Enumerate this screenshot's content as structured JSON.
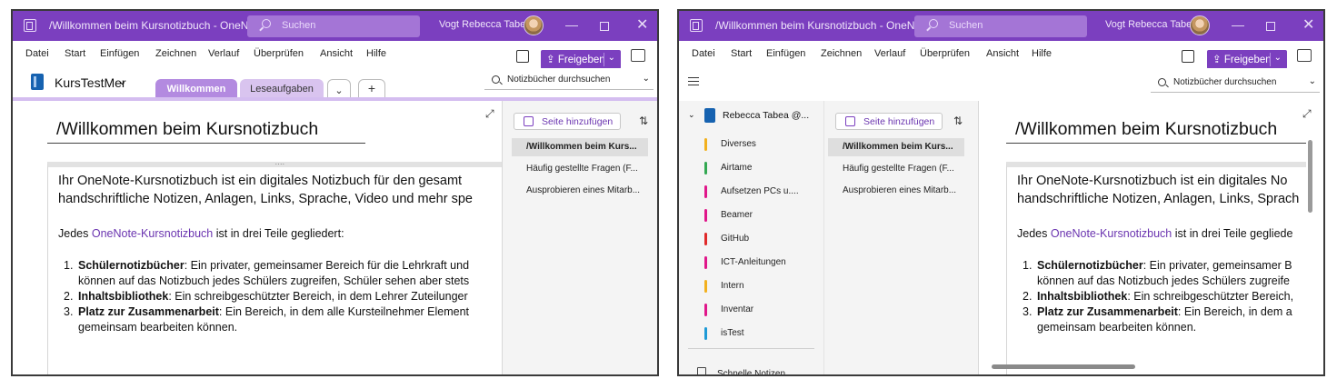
{
  "window": {
    "title": "/Willkommen beim Kursnotizbuch  -  OneN...",
    "search_placeholder": "Suchen",
    "user_name": "Vogt Rebecca Tabea",
    "accent_color": "#7b3fbf"
  },
  "menu": {
    "items": [
      "Datei",
      "Start",
      "Einfügen",
      "Zeichnen",
      "Verlauf",
      "Überprüfen",
      "Ansicht",
      "Hilfe"
    ],
    "share_label": "Freigeben"
  },
  "left": {
    "notebook_name": "KursTestMer",
    "tabs": [
      "Willkommen",
      "Leseaufgaben"
    ],
    "notebook_search": "Notizbücher durchsuchen"
  },
  "page": {
    "title": "/Willkommen beim Kursnotizbuch",
    "para1_line1_full": "Ihr OneNote-Kursnotizbuch ist ein digitales Notizbuch für den gesamt",
    "para1_line2_full": "handschriftliche Notizen, Anlagen, Links, Sprache, Video und mehr spe",
    "para1_line1_cut": "Ihr OneNote-Kursnotizbuch ist ein digitales No",
    "para1_line2_cut": "handschriftliche Notizen, Anlagen, Links, Sprach",
    "para2_prefix": "Jedes ",
    "para2_link": "OneNote-Kursnotizbuch",
    "para2_suffix_full": " ist in drei Teile gegliedert:",
    "para2_suffix_cut": " ist in drei Teile gegliede",
    "list": [
      {
        "num": "1.",
        "bold": "Schülernotizbücher",
        "full": ": Ein privater, gemeinsamer Bereich für die Lehrkraft und",
        "cut": ": Ein privater, gemeinsamer B"
      },
      {
        "num": "",
        "bold": "",
        "full": "können auf das Notizbuch jedes Schülers zugreifen, Schüler sehen aber stets",
        "cut": "können auf das Notizbuch jedes Schülers zugreife"
      },
      {
        "num": "2.",
        "bold": "Inhaltsbibliothek",
        "full": ": Ein schreibgeschützter Bereich, in dem Lehrer Zuteilunger",
        "cut": ": Ein schreibgeschützter Bereich,"
      },
      {
        "num": "3.",
        "bold": "Platz zur Zusammenarbeit",
        "full": ": Ein Bereich, in dem alle Kursteilnehmer Element",
        "cut": ": Ein Bereich, in dem a"
      },
      {
        "num": "",
        "bold": "",
        "full": "gemeinsam bearbeiten können.",
        "cut": "gemeinsam bearbeiten können."
      }
    ]
  },
  "pages_pane": {
    "add_label": "Seite hinzufügen",
    "items": [
      "/Willkommen beim Kurs...",
      "Häufig gestellte Fragen (F...",
      "Ausprobieren eines Mitarb..."
    ]
  },
  "sections_pane": {
    "notebook": "Rebecca Tabea @...",
    "sections": [
      {
        "label": "Diverses",
        "color": "#f2b01e"
      },
      {
        "label": "Airtame",
        "color": "#33a852"
      },
      {
        "label": "Aufsetzen PCs u....",
        "color": "#e0168a"
      },
      {
        "label": "Beamer",
        "color": "#e0168a"
      },
      {
        "label": "GitHub",
        "color": "#e02a2a"
      },
      {
        "label": "ICT-Anleitungen",
        "color": "#e0168a"
      },
      {
        "label": "Intern",
        "color": "#f2b01e"
      },
      {
        "label": "Inventar",
        "color": "#e0168a"
      },
      {
        "label": "isTest",
        "color": "#1e9ad6"
      }
    ],
    "quick_notes": "Schnelle Notizen"
  }
}
